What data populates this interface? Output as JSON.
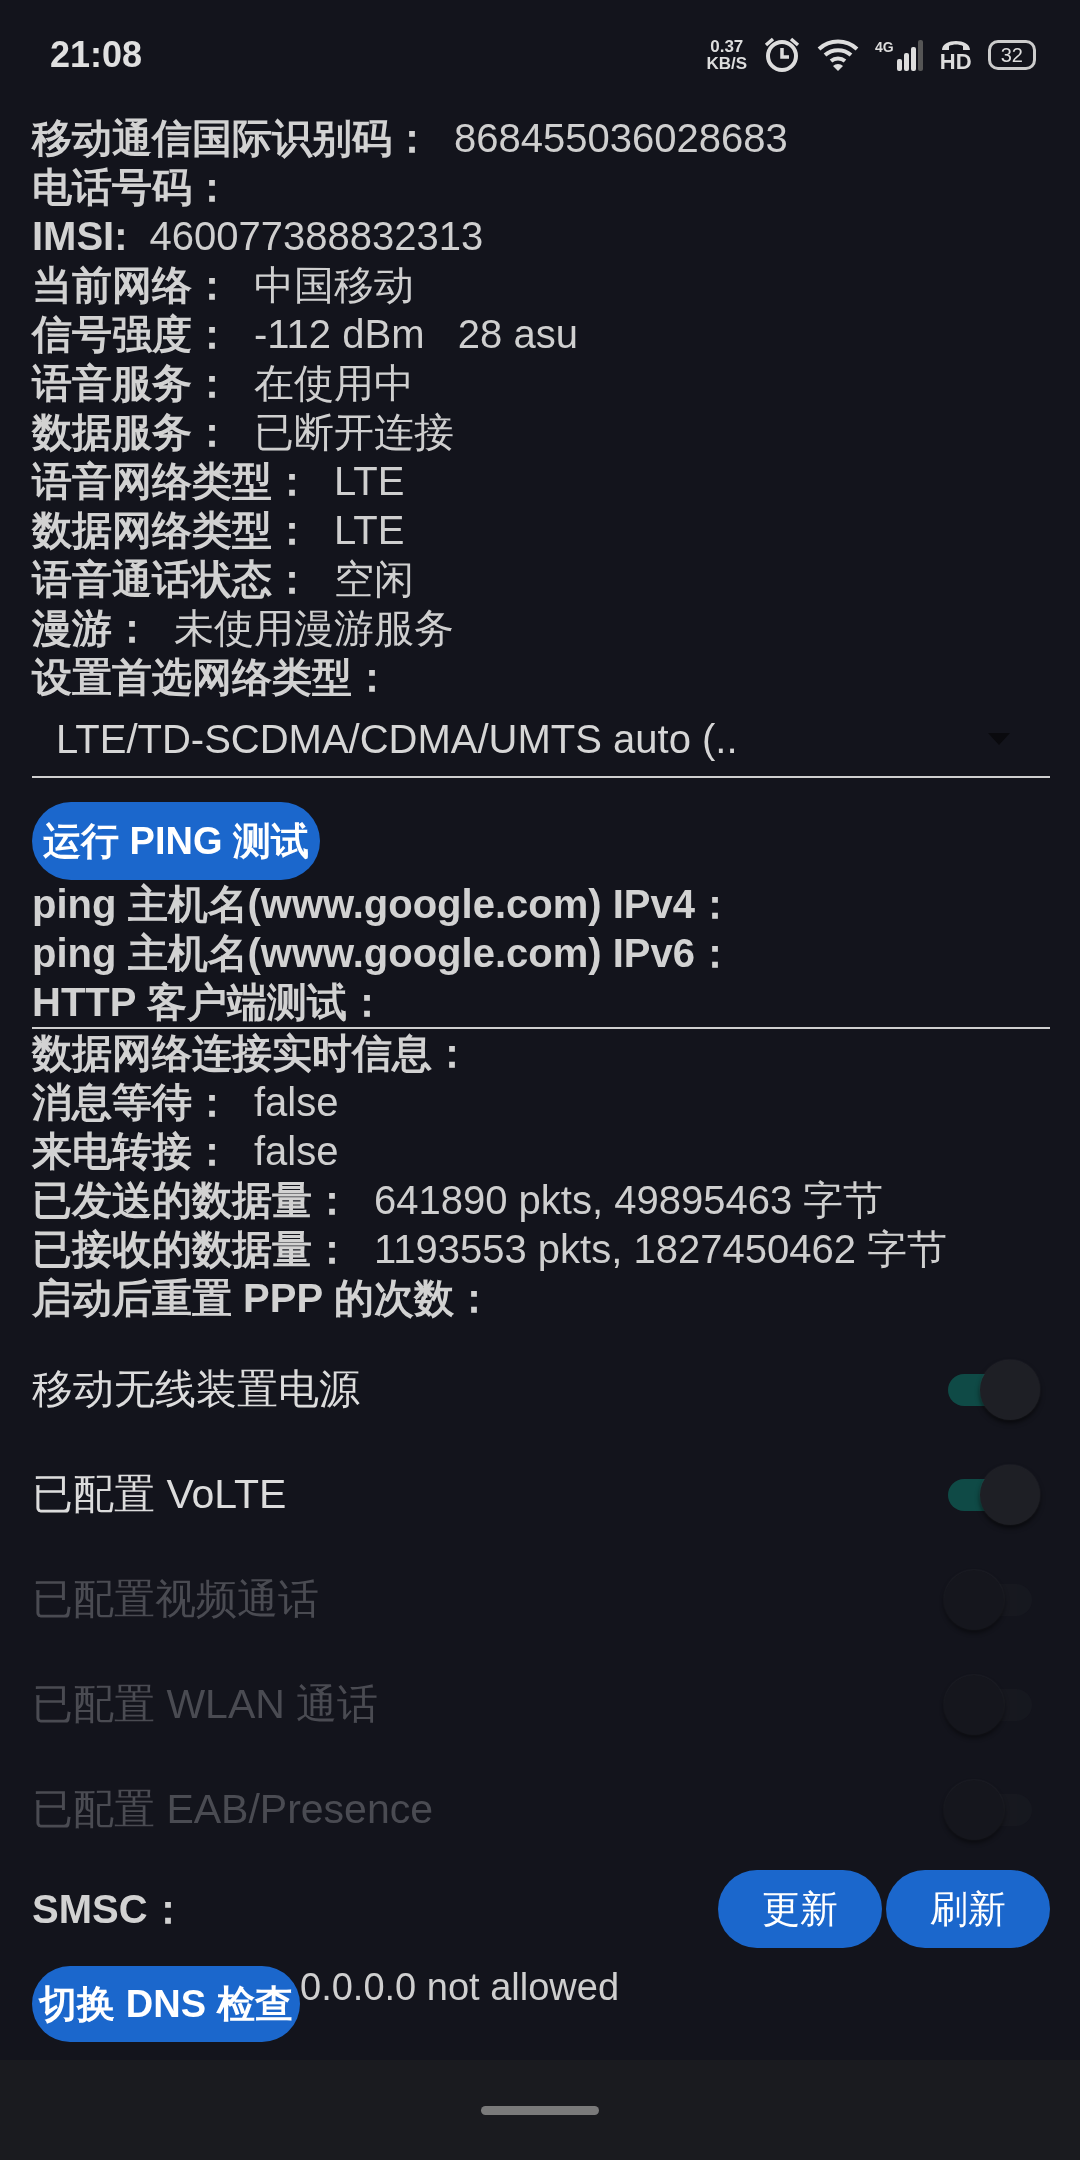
{
  "status_bar": {
    "time": "21:08",
    "net_speed": "0.37",
    "net_unit": "KB/S",
    "network_type": "4G",
    "hd": "HD",
    "battery": "32"
  },
  "info": [
    {
      "label": "移动通信国际识别码：",
      "value": "868455036028683"
    },
    {
      "label": "电话号码："
    },
    {
      "label": "IMSI:",
      "value": "460077388832313"
    },
    {
      "label": "当前网络：",
      "value": "中国移动"
    },
    {
      "label": "信号强度：",
      "value": "-112 dBm   28 asu"
    },
    {
      "label": "语音服务：",
      "value": "在使用中"
    },
    {
      "label": "数据服务：",
      "value": "已断开连接"
    },
    {
      "label": "语音网络类型：",
      "value": "LTE"
    },
    {
      "label": "数据网络类型：",
      "value": "LTE"
    },
    {
      "label": "语音通话状态：",
      "value": "空闲"
    },
    {
      "label": "漫游：",
      "value": "未使用漫游服务"
    },
    {
      "label": "设置首选网络类型："
    }
  ],
  "preferred_network": {
    "value": "LTE/TD-SCDMA/CDMA/UMTS auto (.."
  },
  "ping_button": "运行 PING 测试",
  "ping_results": [
    "ping 主机名(www.google.com) IPv4：",
    "ping 主机名(www.google.com) IPv6：",
    "HTTP 客户端测试："
  ],
  "data_info": [
    {
      "label": "数据网络连接实时信息："
    },
    {
      "label": "消息等待：",
      "value": "false"
    },
    {
      "label": "来电转接：",
      "value": "false"
    },
    {
      "label": "已发送的数据量：",
      "value": "641890 pkts, 49895463 字节"
    },
    {
      "label": "已接收的数据量：",
      "value": "1193553 pkts, 1827450462 字节"
    },
    {
      "label": "启动后重置 PPP 的次数："
    }
  ],
  "toggles": [
    {
      "label": "移动无线装置电源",
      "on": true,
      "disabled": false
    },
    {
      "label": "已配置 VoLTE",
      "on": true,
      "disabled": false
    },
    {
      "label": "已配置视频通话",
      "on": false,
      "disabled": true
    },
    {
      "label": "已配置 WLAN 通话",
      "on": false,
      "disabled": true
    },
    {
      "label": "已配置 EAB/Presence",
      "on": false,
      "disabled": true
    }
  ],
  "smsc": {
    "label": "SMSC：",
    "buttons": [
      "更新",
      "刷新"
    ]
  },
  "dns": {
    "button": "切换 DNS 检查",
    "status": "0.0.0.0 not allowed"
  }
}
